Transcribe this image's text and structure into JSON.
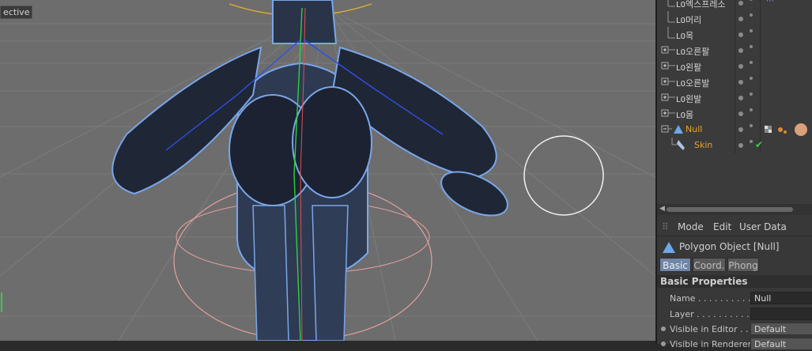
{
  "viewport": {
    "label": "ective"
  },
  "outliner": {
    "items": [
      {
        "name": "엑스프레소",
        "expandable": false,
        "color": "#d4d4d4"
      },
      {
        "name": "머리",
        "expandable": false,
        "color": "#d4d4d4"
      },
      {
        "name": "목",
        "expandable": false,
        "color": "#d4d4d4"
      },
      {
        "name": "오른팔",
        "expandable": true,
        "color": "#d4d4d4"
      },
      {
        "name": "왼팔",
        "expandable": true,
        "color": "#d4d4d4"
      },
      {
        "name": "오른발",
        "expandable": true,
        "color": "#d4d4d4"
      },
      {
        "name": "왼발",
        "expandable": true,
        "color": "#d4d4d4"
      },
      {
        "name": "몸",
        "expandable": true,
        "color": "#d4d4d4"
      },
      {
        "name": "Null",
        "expandable": true,
        "color": "#e8a22c"
      },
      {
        "name": "Skin",
        "expandable": false,
        "color": "#e8a22c"
      }
    ]
  },
  "attributes": {
    "menu": {
      "mode": "Mode",
      "edit": "Edit",
      "user_data": "User Data"
    },
    "object_title": "Polygon Object [Null]",
    "tabs": {
      "basic": "Basic",
      "coord": "Coord.",
      "phong": "Phong"
    },
    "section": "Basic Properties",
    "fields": {
      "name_label": "Name . . . . . . . . . . .",
      "name_value": "Null",
      "layer_label": "Layer . . . . . . . . . . .",
      "layer_value": "",
      "vis_editor_label": "Visible in Editor . .",
      "vis_editor_value": "Default",
      "vis_render_label": "Visible in Renderer",
      "vis_render_value": "Default"
    }
  },
  "colors": {
    "accent": "#e8a22c",
    "tab_active": "#6f86a8",
    "mesh": "#7aa6e8"
  }
}
